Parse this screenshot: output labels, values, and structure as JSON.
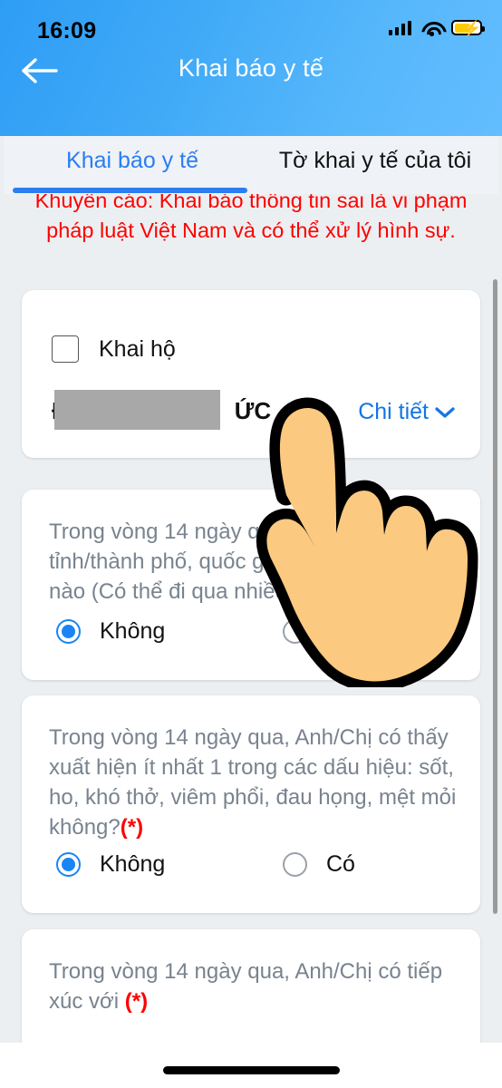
{
  "status_bar": {
    "time": "16:09",
    "signal_icon": "cellular-signal-icon",
    "wifi_icon": "wifi-icon",
    "battery_icon": "battery-charging-icon"
  },
  "header": {
    "title": "Khai báo y tế",
    "back_icon": "back-arrow-icon",
    "gradient_from": "#2e9df5",
    "gradient_to": "#63bdff"
  },
  "tabs": [
    {
      "label": "Khai báo y tế",
      "active": true,
      "color": "#2a7ef0"
    },
    {
      "label": "Tờ khai y tế của tôi",
      "active": false,
      "color": "#111111"
    }
  ],
  "warning": {
    "text": "Khuyến cáo: Khai báo thông tin sai là vi phạm pháp luật Việt Nam và có thể xử lý hình sự.",
    "color": "#ff0000"
  },
  "person_card": {
    "checkbox_label": "Khai hộ",
    "checkbox_checked": false,
    "name_prefix": "Đ",
    "name_suffix": "ỨC",
    "name_redacted": true,
    "detail_label": "Chi tiết",
    "detail_icon": "chevron-down-icon",
    "detail_color": "#1275e6"
  },
  "questions": [
    {
      "text": "Trong vòng 14 ngày qua, Anh/Chị có đến tỉnh/thành phố, quốc gia/vùng lãnh thổ nào (Có thể đi qua nhiều nơi)",
      "required_mark": "",
      "options": [
        {
          "label": "Không",
          "selected": true
        },
        {
          "label": "Có",
          "selected": false
        }
      ]
    },
    {
      "text": "Trong vòng 14 ngày qua, Anh/Chị có thấy xuất hiện ít nhất 1 trong các dấu hiệu: sốt, ho, khó thở, viêm phổi, đau họng, mệt mỏi không?",
      "required_mark": "(*)",
      "options": [
        {
          "label": "Không",
          "selected": true
        },
        {
          "label": "Có",
          "selected": false
        }
      ]
    },
    {
      "text": "Trong vòng 14 ngày qua, Anh/Chị có tiếp xúc với ",
      "required_mark": "(*)",
      "options": []
    }
  ],
  "cursor": {
    "icon": "pointing-hand-cursor",
    "skin_color": "#fbc97f",
    "outline_color": "#000000"
  },
  "scrollbar": {
    "icon": "vertical-scrollbar"
  },
  "home_indicator": {
    "icon": "home-indicator-bar"
  }
}
